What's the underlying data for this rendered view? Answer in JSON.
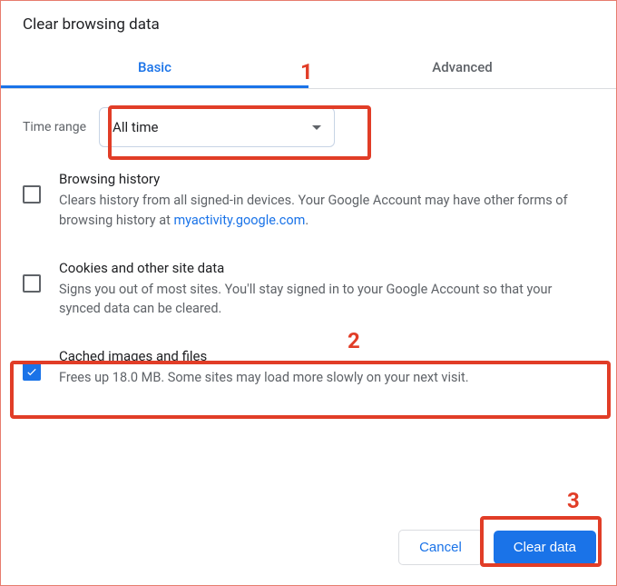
{
  "title": "Clear browsing data",
  "tabs": {
    "basic": "Basic",
    "advanced": "Advanced"
  },
  "time_range": {
    "label": "Time range",
    "selected": "All time"
  },
  "options": {
    "browsing_history": {
      "title": "Browsing history",
      "desc_pre": "Clears history from all signed-in devices. Your Google Account may have other forms of browsing history at ",
      "link_text": "myactivity.google.com",
      "desc_post": ".",
      "checked": false
    },
    "cookies": {
      "title": "Cookies and other site data",
      "desc": "Signs you out of most sites. You'll stay signed in to your Google Account so that your synced data can be cleared.",
      "checked": false
    },
    "cache": {
      "title": "Cached images and files",
      "desc": "Frees up 18.0 MB. Some sites may load more slowly on your next visit.",
      "checked": true
    }
  },
  "buttons": {
    "cancel": "Cancel",
    "clear": "Clear data"
  },
  "annotations": {
    "a1": "1",
    "a2": "2",
    "a3": "3"
  }
}
